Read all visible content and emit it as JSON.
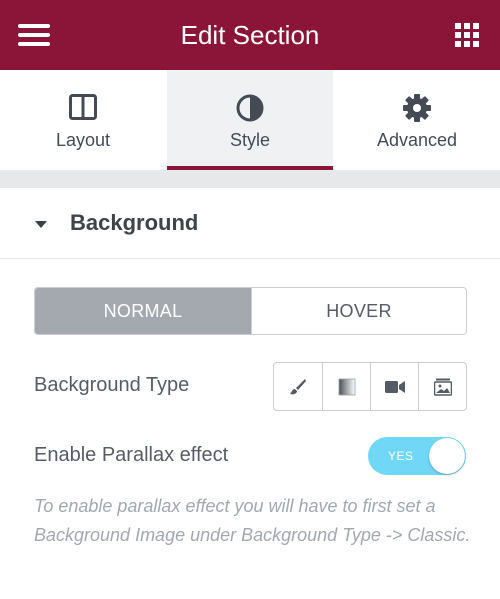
{
  "header": {
    "title": "Edit Section",
    "menu_icon": "hamburger-menu-icon",
    "apps_icon": "grid-apps-icon",
    "brand_color": "#8a1538"
  },
  "tabs": [
    {
      "label": "Layout",
      "icon": "layout-columns-icon",
      "active": false
    },
    {
      "label": "Style",
      "icon": "half-circle-contrast-icon",
      "active": true
    },
    {
      "label": "Advanced",
      "icon": "gear-icon",
      "active": false
    }
  ],
  "section": {
    "title": "Background",
    "expanded": true
  },
  "state_toggle": {
    "normal_label": "NORMAL",
    "hover_label": "HOVER",
    "selected": "NORMAL"
  },
  "background_type": {
    "label": "Background Type",
    "options": [
      "classic-brush-icon",
      "gradient-icon",
      "video-camera-icon",
      "slideshow-image-icon"
    ]
  },
  "parallax": {
    "label": "Enable Parallax effect",
    "switch_text": "YES",
    "enabled": true,
    "switch_color": "#71d7f7"
  },
  "help_text": "To enable parallax effect you will have to first set a Background Image under Background Type -> Classic."
}
